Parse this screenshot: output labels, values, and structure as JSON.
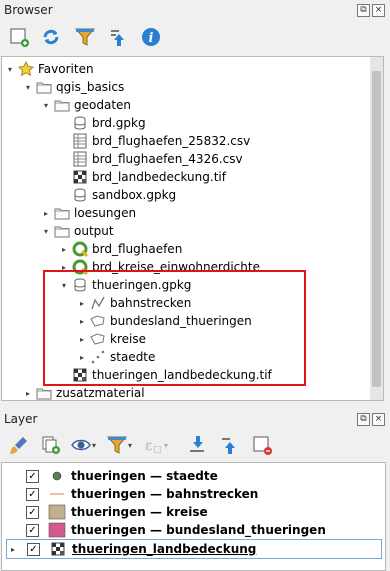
{
  "browser": {
    "title": "Browser",
    "tree": [
      {
        "label": "Favoriten",
        "depth": 0,
        "arrow": "▾",
        "icon": "star-icon"
      },
      {
        "label": "qgis_basics",
        "depth": 1,
        "arrow": "▾",
        "icon": "folder-icon"
      },
      {
        "label": "geodaten",
        "depth": 2,
        "arrow": "▾",
        "icon": "folder-icon"
      },
      {
        "label": "brd.gpkg",
        "depth": 3,
        "arrow": "",
        "icon": "geopackage-icon"
      },
      {
        "label": "brd_flughaefen_25832.csv",
        "depth": 3,
        "arrow": "",
        "icon": "csv-table-icon"
      },
      {
        "label": "brd_flughaefen_4326.csv",
        "depth": 3,
        "arrow": "",
        "icon": "csv-table-icon"
      },
      {
        "label": "brd_landbedeckung.tif",
        "depth": 3,
        "arrow": "",
        "icon": "raster-icon"
      },
      {
        "label": "sandbox.gpkg",
        "depth": 3,
        "arrow": "",
        "icon": "geopackage-icon"
      },
      {
        "label": "loesungen",
        "depth": 2,
        "arrow": "▸",
        "icon": "folder-icon"
      },
      {
        "label": "output",
        "depth": 2,
        "arrow": "▾",
        "icon": "folder-icon"
      },
      {
        "label": "brd_flughaefen",
        "depth": 3,
        "arrow": "▸",
        "icon": "qgis-project-icon"
      },
      {
        "label": "brd_kreise_einwohnerdichte",
        "depth": 3,
        "arrow": "▸",
        "icon": "qgis-project-icon"
      },
      {
        "label": "thueringen.gpkg",
        "depth": 3,
        "arrow": "▾",
        "icon": "geopackage-icon"
      },
      {
        "label": "bahnstrecken",
        "depth": 4,
        "arrow": "▸",
        "icon": "line-layer-icon"
      },
      {
        "label": "bundesland_thueringen",
        "depth": 4,
        "arrow": "▸",
        "icon": "polygon-layer-icon"
      },
      {
        "label": "kreise",
        "depth": 4,
        "arrow": "▸",
        "icon": "polygon-layer-icon"
      },
      {
        "label": "staedte",
        "depth": 4,
        "arrow": "▸",
        "icon": "point-layer-icon"
      },
      {
        "label": "thueringen_landbedeckung.tif",
        "depth": 3,
        "arrow": "",
        "icon": "raster-icon"
      },
      {
        "label": "zusatzmaterial",
        "depth": 1,
        "arrow": "▸",
        "icon": "folder-icon"
      }
    ]
  },
  "layers": {
    "title": "Layer",
    "items": [
      {
        "label": "thueringen — staedte",
        "symbol": "point",
        "color": "#5c7f4f"
      },
      {
        "label": "thueringen — bahnstrecken",
        "symbol": "line",
        "color": "#e8a88a"
      },
      {
        "label": "thueringen — kreise",
        "symbol": "fill",
        "color": "#c2b08c"
      },
      {
        "label": "thueringen — bundesland_thueringen",
        "symbol": "fill",
        "color": "#d35b8c"
      },
      {
        "label": "thueringen_landbedeckung",
        "symbol": "raster",
        "color": "#444444"
      }
    ]
  },
  "colors": {
    "highlight": "#e0121b",
    "accent": "#2a7fd4"
  }
}
